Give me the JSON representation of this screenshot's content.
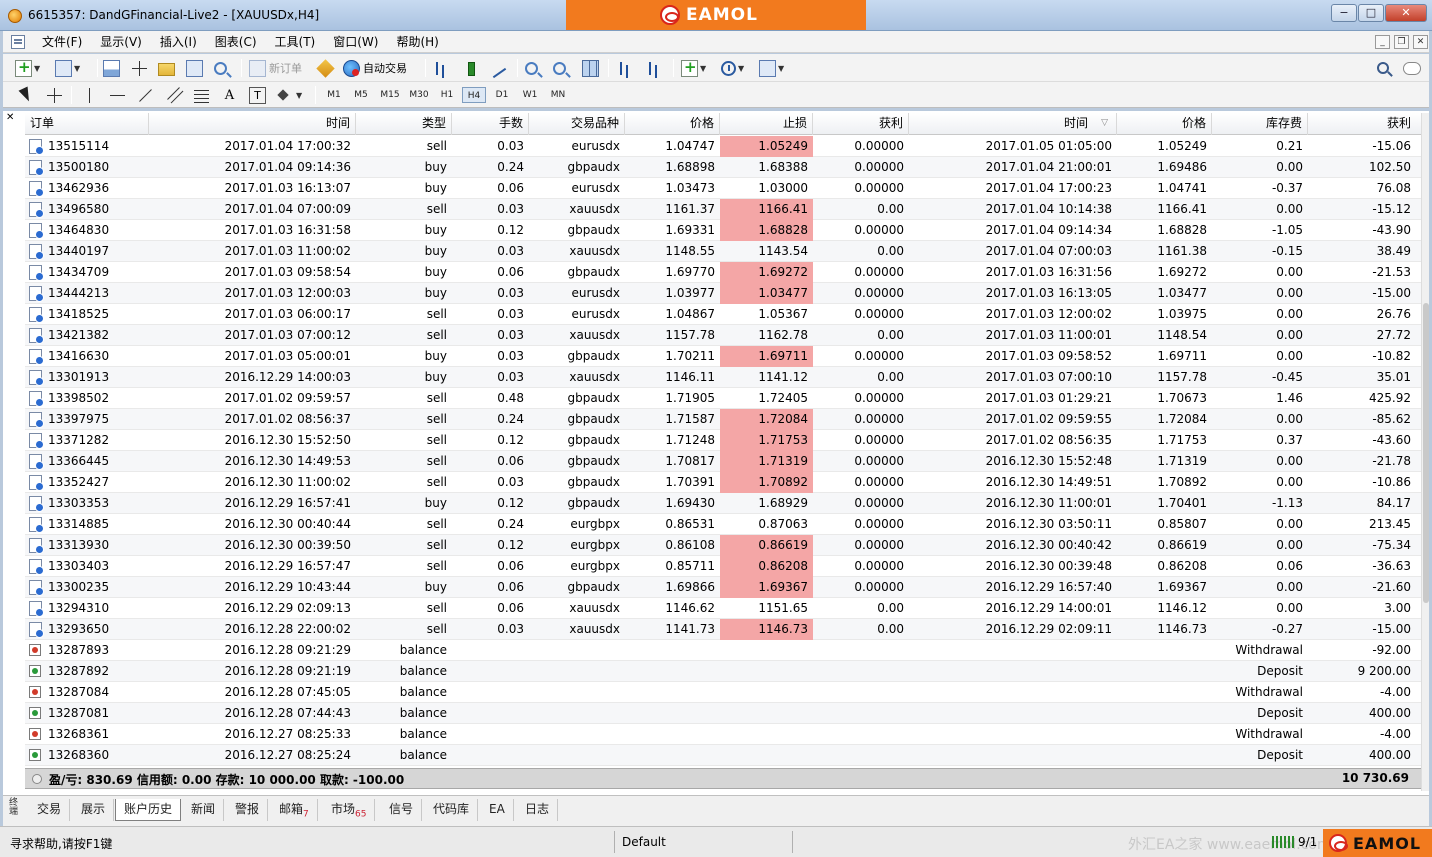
{
  "window": {
    "title": "6615357: DandGFinancial-Live2 - [XAUUSDx,H4]",
    "brand": "EAMOL",
    "controls": [
      "−",
      "□",
      "✕"
    ]
  },
  "menu": [
    "文件(F)",
    "显示(V)",
    "插入(I)",
    "图表(C)",
    "工具(T)",
    "窗口(W)",
    "帮助(H)"
  ],
  "toolbar": {
    "new_order_label": "新订单",
    "auto_trading_label": "自动交易",
    "timeframes": [
      "M1",
      "M5",
      "M15",
      "M30",
      "H1",
      "H4",
      "D1",
      "W1",
      "MN"
    ],
    "active_timeframe": "H4"
  },
  "table": {
    "headers": {
      "order": "订单",
      "open_time": "时间",
      "type": "类型",
      "lots": "手数",
      "symbol": "交易品种",
      "open_price": "价格",
      "stop_loss": "止损",
      "take_profit": "获利",
      "close_time": "时间",
      "close_price": "价格",
      "swap": "库存费",
      "profit": "获利"
    },
    "trades": [
      {
        "order": "13515114",
        "open_time": "2017.01.04 17:00:32",
        "type": "sell",
        "lots": "0.03",
        "symbol": "eurusdx",
        "open_price": "1.04747",
        "sl": "1.05249",
        "sl_hit": true,
        "tp": "0.00000",
        "close_time": "2017.01.05 01:05:00",
        "close_price": "1.05249",
        "swap": "0.21",
        "profit": "-15.06"
      },
      {
        "order": "13500180",
        "open_time": "2017.01.04 09:14:36",
        "type": "buy",
        "lots": "0.24",
        "symbol": "gbpaudx",
        "open_price": "1.68898",
        "sl": "1.68388",
        "sl_hit": false,
        "tp": "0.00000",
        "close_time": "2017.01.04 21:00:01",
        "close_price": "1.69486",
        "swap": "0.00",
        "profit": "102.50"
      },
      {
        "order": "13462936",
        "open_time": "2017.01.03 16:13:07",
        "type": "buy",
        "lots": "0.06",
        "symbol": "eurusdx",
        "open_price": "1.03473",
        "sl": "1.03000",
        "sl_hit": false,
        "tp": "0.00000",
        "close_time": "2017.01.04 17:00:23",
        "close_price": "1.04741",
        "swap": "-0.37",
        "profit": "76.08"
      },
      {
        "order": "13496580",
        "open_time": "2017.01.04 07:00:09",
        "type": "sell",
        "lots": "0.03",
        "symbol": "xauusdx",
        "open_price": "1161.37",
        "sl": "1166.41",
        "sl_hit": true,
        "tp": "0.00",
        "close_time": "2017.01.04 10:14:38",
        "close_price": "1166.41",
        "swap": "0.00",
        "profit": "-15.12"
      },
      {
        "order": "13464830",
        "open_time": "2017.01.03 16:31:58",
        "type": "buy",
        "lots": "0.12",
        "symbol": "gbpaudx",
        "open_price": "1.69331",
        "sl": "1.68828",
        "sl_hit": true,
        "tp": "0.00000",
        "close_time": "2017.01.04 09:14:34",
        "close_price": "1.68828",
        "swap": "-1.05",
        "profit": "-43.90"
      },
      {
        "order": "13440197",
        "open_time": "2017.01.03 11:00:02",
        "type": "buy",
        "lots": "0.03",
        "symbol": "xauusdx",
        "open_price": "1148.55",
        "sl": "1143.54",
        "sl_hit": false,
        "tp": "0.00",
        "close_time": "2017.01.04 07:00:03",
        "close_price": "1161.38",
        "swap": "-0.15",
        "profit": "38.49"
      },
      {
        "order": "13434709",
        "open_time": "2017.01.03 09:58:54",
        "type": "buy",
        "lots": "0.06",
        "symbol": "gbpaudx",
        "open_price": "1.69770",
        "sl": "1.69272",
        "sl_hit": true,
        "tp": "0.00000",
        "close_time": "2017.01.03 16:31:56",
        "close_price": "1.69272",
        "swap": "0.00",
        "profit": "-21.53"
      },
      {
        "order": "13444213",
        "open_time": "2017.01.03 12:00:03",
        "type": "buy",
        "lots": "0.03",
        "symbol": "eurusdx",
        "open_price": "1.03977",
        "sl": "1.03477",
        "sl_hit": true,
        "tp": "0.00000",
        "close_time": "2017.01.03 16:13:05",
        "close_price": "1.03477",
        "swap": "0.00",
        "profit": "-15.00"
      },
      {
        "order": "13418525",
        "open_time": "2017.01.03 06:00:17",
        "type": "sell",
        "lots": "0.03",
        "symbol": "eurusdx",
        "open_price": "1.04867",
        "sl": "1.05367",
        "sl_hit": false,
        "tp": "0.00000",
        "close_time": "2017.01.03 12:00:02",
        "close_price": "1.03975",
        "swap": "0.00",
        "profit": "26.76"
      },
      {
        "order": "13421382",
        "open_time": "2017.01.03 07:00:12",
        "type": "sell",
        "lots": "0.03",
        "symbol": "xauusdx",
        "open_price": "1157.78",
        "sl": "1162.78",
        "sl_hit": false,
        "tp": "0.00",
        "close_time": "2017.01.03 11:00:01",
        "close_price": "1148.54",
        "swap": "0.00",
        "profit": "27.72"
      },
      {
        "order": "13416630",
        "open_time": "2017.01.03 05:00:01",
        "type": "buy",
        "lots": "0.03",
        "symbol": "gbpaudx",
        "open_price": "1.70211",
        "sl": "1.69711",
        "sl_hit": true,
        "tp": "0.00000",
        "close_time": "2017.01.03 09:58:52",
        "close_price": "1.69711",
        "swap": "0.00",
        "profit": "-10.82"
      },
      {
        "order": "13301913",
        "open_time": "2016.12.29 14:00:03",
        "type": "buy",
        "lots": "0.03",
        "symbol": "xauusdx",
        "open_price": "1146.11",
        "sl": "1141.12",
        "sl_hit": false,
        "tp": "0.00",
        "close_time": "2017.01.03 07:00:10",
        "close_price": "1157.78",
        "swap": "-0.45",
        "profit": "35.01"
      },
      {
        "order": "13398502",
        "open_time": "2017.01.02 09:59:57",
        "type": "sell",
        "lots": "0.48",
        "symbol": "gbpaudx",
        "open_price": "1.71905",
        "sl": "1.72405",
        "sl_hit": false,
        "tp": "0.00000",
        "close_time": "2017.01.03 01:29:21",
        "close_price": "1.70673",
        "swap": "1.46",
        "profit": "425.92"
      },
      {
        "order": "13397975",
        "open_time": "2017.01.02 08:56:37",
        "type": "sell",
        "lots": "0.24",
        "symbol": "gbpaudx",
        "open_price": "1.71587",
        "sl": "1.72084",
        "sl_hit": true,
        "tp": "0.00000",
        "close_time": "2017.01.02 09:59:55",
        "close_price": "1.72084",
        "swap": "0.00",
        "profit": "-85.62"
      },
      {
        "order": "13371282",
        "open_time": "2016.12.30 15:52:50",
        "type": "sell",
        "lots": "0.12",
        "symbol": "gbpaudx",
        "open_price": "1.71248",
        "sl": "1.71753",
        "sl_hit": true,
        "tp": "0.00000",
        "close_time": "2017.01.02 08:56:35",
        "close_price": "1.71753",
        "swap": "0.37",
        "profit": "-43.60"
      },
      {
        "order": "13366445",
        "open_time": "2016.12.30 14:49:53",
        "type": "sell",
        "lots": "0.06",
        "symbol": "gbpaudx",
        "open_price": "1.70817",
        "sl": "1.71319",
        "sl_hit": true,
        "tp": "0.00000",
        "close_time": "2016.12.30 15:52:48",
        "close_price": "1.71319",
        "swap": "0.00",
        "profit": "-21.78"
      },
      {
        "order": "13352427",
        "open_time": "2016.12.30 11:00:02",
        "type": "sell",
        "lots": "0.03",
        "symbol": "gbpaudx",
        "open_price": "1.70391",
        "sl": "1.70892",
        "sl_hit": true,
        "tp": "0.00000",
        "close_time": "2016.12.30 14:49:51",
        "close_price": "1.70892",
        "swap": "0.00",
        "profit": "-10.86"
      },
      {
        "order": "13303353",
        "open_time": "2016.12.29 16:57:41",
        "type": "buy",
        "lots": "0.12",
        "symbol": "gbpaudx",
        "open_price": "1.69430",
        "sl": "1.68929",
        "sl_hit": false,
        "tp": "0.00000",
        "close_time": "2016.12.30 11:00:01",
        "close_price": "1.70401",
        "swap": "-1.13",
        "profit": "84.17"
      },
      {
        "order": "13314885",
        "open_time": "2016.12.30 00:40:44",
        "type": "sell",
        "lots": "0.24",
        "symbol": "eurgbpx",
        "open_price": "0.86531",
        "sl": "0.87063",
        "sl_hit": false,
        "tp": "0.00000",
        "close_time": "2016.12.30 03:50:11",
        "close_price": "0.85807",
        "swap": "0.00",
        "profit": "213.45"
      },
      {
        "order": "13313930",
        "open_time": "2016.12.30 00:39:50",
        "type": "sell",
        "lots": "0.12",
        "symbol": "eurgbpx",
        "open_price": "0.86108",
        "sl": "0.86619",
        "sl_hit": true,
        "tp": "0.00000",
        "close_time": "2016.12.30 00:40:42",
        "close_price": "0.86619",
        "swap": "0.00",
        "profit": "-75.34"
      },
      {
        "order": "13303403",
        "open_time": "2016.12.29 16:57:47",
        "type": "sell",
        "lots": "0.06",
        "symbol": "eurgbpx",
        "open_price": "0.85711",
        "sl": "0.86208",
        "sl_hit": true,
        "tp": "0.00000",
        "close_time": "2016.12.30 00:39:48",
        "close_price": "0.86208",
        "swap": "0.06",
        "profit": "-36.63"
      },
      {
        "order": "13300235",
        "open_time": "2016.12.29 10:43:44",
        "type": "buy",
        "lots": "0.06",
        "symbol": "gbpaudx",
        "open_price": "1.69866",
        "sl": "1.69367",
        "sl_hit": true,
        "tp": "0.00000",
        "close_time": "2016.12.29 16:57:40",
        "close_price": "1.69367",
        "swap": "0.00",
        "profit": "-21.60"
      },
      {
        "order": "13294310",
        "open_time": "2016.12.29 02:09:13",
        "type": "sell",
        "lots": "0.06",
        "symbol": "xauusdx",
        "open_price": "1146.62",
        "sl": "1151.65",
        "sl_hit": false,
        "tp": "0.00",
        "close_time": "2016.12.29 14:00:01",
        "close_price": "1146.12",
        "swap": "0.00",
        "profit": "3.00"
      },
      {
        "order": "13293650",
        "open_time": "2016.12.28 22:00:02",
        "type": "sell",
        "lots": "0.03",
        "symbol": "xauusdx",
        "open_price": "1141.73",
        "sl": "1146.73",
        "sl_hit": true,
        "tp": "0.00",
        "close_time": "2016.12.29 02:09:11",
        "close_price": "1146.73",
        "swap": "-0.27",
        "profit": "-15.00"
      }
    ],
    "balances": [
      {
        "order": "13287893",
        "time": "2016.12.28 09:21:29",
        "type": "balance",
        "comment": "Withdrawal",
        "profit": "-92.00",
        "kind": "withdrawal"
      },
      {
        "order": "13287892",
        "time": "2016.12.28 09:21:19",
        "type": "balance",
        "comment": "Deposit",
        "profit": "9 200.00",
        "kind": "deposit"
      },
      {
        "order": "13287084",
        "time": "2016.12.28 07:45:05",
        "type": "balance",
        "comment": "Withdrawal",
        "profit": "-4.00",
        "kind": "withdrawal"
      },
      {
        "order": "13287081",
        "time": "2016.12.28 07:44:43",
        "type": "balance",
        "comment": "Deposit",
        "profit": "400.00",
        "kind": "deposit"
      },
      {
        "order": "13268361",
        "time": "2016.12.27 08:25:33",
        "type": "balance",
        "comment": "Withdrawal",
        "profit": "-4.00",
        "kind": "withdrawal"
      },
      {
        "order": "13268360",
        "time": "2016.12.27 08:25:24",
        "type": "balance",
        "comment": "Deposit",
        "profit": "400.00",
        "kind": "deposit"
      }
    ]
  },
  "summary": {
    "text": "盈/亏: 830.69  信用额: 0.00  存款: 10 000.00  取款: -100.00",
    "total": "10 730.69"
  },
  "tabs": {
    "vertical_label": "终端",
    "items": [
      {
        "label": "交易",
        "badge": ""
      },
      {
        "label": "展示",
        "badge": ""
      },
      {
        "label": "账户历史",
        "badge": ""
      },
      {
        "label": "新闻",
        "badge": ""
      },
      {
        "label": "警报",
        "badge": ""
      },
      {
        "label": "邮箱",
        "badge": "7"
      },
      {
        "label": "市场",
        "badge": "65"
      },
      {
        "label": "信号",
        "badge": ""
      },
      {
        "label": "代码库",
        "badge": ""
      },
      {
        "label": "EA",
        "badge": ""
      },
      {
        "label": "日志",
        "badge": ""
      }
    ],
    "active_index": 2
  },
  "status": {
    "help": "寻求帮助,请按F1键",
    "profile": "Default",
    "connection": "9/1",
    "watermark": "外汇EA之家 www.eaemol.com"
  },
  "colors": {
    "sl_hit_bg": "#f4a6a6",
    "brand_orange": "#f27a1e"
  }
}
